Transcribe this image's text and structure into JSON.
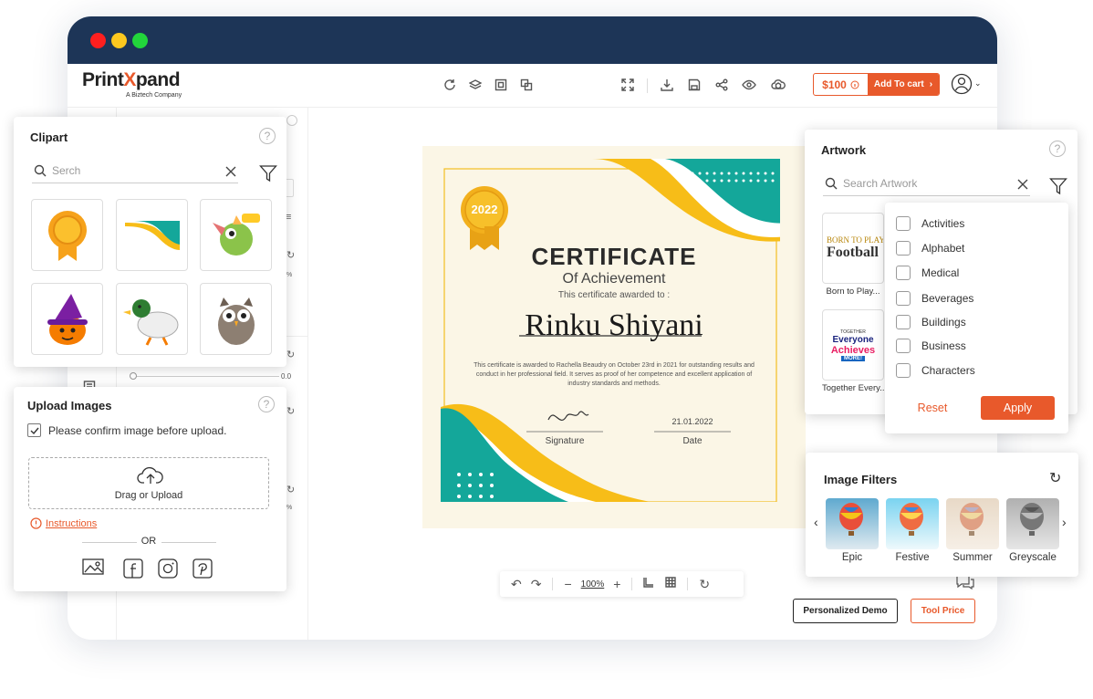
{
  "app": {
    "brand_pre": "Print",
    "brand_x": "X",
    "brand_post": "pand",
    "company": "A Biztech Company"
  },
  "toolbar": {
    "price": "$100",
    "add_to_cart": "Add To cart"
  },
  "clipart": {
    "title": "Clipart",
    "search_placeholder": "Serch",
    "help": "?"
  },
  "upload": {
    "title": "Upload Images",
    "help": "?",
    "confirm_label": "Please confirm image before upload.",
    "drop_label": "Drag or Upload",
    "instructions": "Instructions",
    "or": "OR"
  },
  "certificate": {
    "badge_year": "2022",
    "heading": "CERTIFICATE",
    "subheading": "Of Achievement",
    "awarded_to": "This certificate awarded to :",
    "recipient": "Rinku Shiyani",
    "body": "This certificate is awarded to Rachella Beaudry on October 23rd in 2021 for outstanding results and conduct in her professional field. It serves as proof of her competence and excellent application of industry standards and methods.",
    "signature_label": "Signature",
    "date_value": "21.01.2022",
    "date_label": "Date"
  },
  "artwork": {
    "title": "Artwork",
    "help": "?",
    "search_placeholder": "Search Artwork",
    "items": [
      {
        "caption": "Born to Play...",
        "art_line1": "BORN TO PLAY",
        "art_line2": "Football"
      },
      {
        "caption": "Together Every...",
        "art_line1": "TOGETHER",
        "art_line2": "Everyone",
        "art_line3": "Achieves",
        "art_line4": "MORE!"
      }
    ]
  },
  "filter_menu": {
    "options": [
      "Activities",
      "Alphabet",
      "Medical",
      "Beverages",
      "Buildings",
      "Business",
      "Characters"
    ],
    "reset": "Reset",
    "apply": "Apply"
  },
  "image_filters": {
    "title": "Image Filters",
    "items": [
      "Epic",
      "Festive",
      "Summer",
      "Greyscale"
    ]
  },
  "canvas_controls": {
    "zoom": "100%"
  },
  "left_panel": {
    "slider_value": "0.0",
    "pct_a": "%",
    "pct_b": "%"
  },
  "footer": {
    "demo": "Personalized Demo",
    "tool_price": "Tool Price"
  },
  "colors": {
    "accent": "#e8592b",
    "navy": "#1d3557",
    "teal": "#14a79a",
    "yellow": "#f7bd18"
  }
}
